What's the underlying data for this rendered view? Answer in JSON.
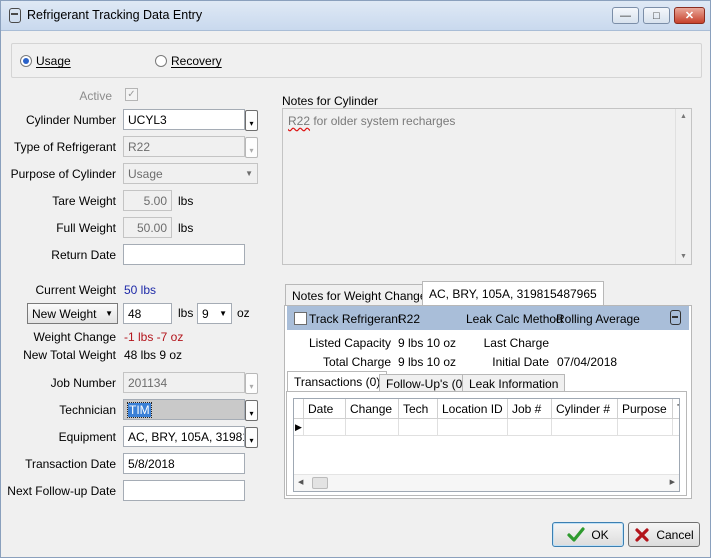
{
  "window": {
    "title": "Refrigerant Tracking Data Entry",
    "minimize": "—",
    "maximize": "□",
    "close": "✕"
  },
  "mode": {
    "usage": "Usage",
    "recovery": "Recovery",
    "selected": "usage"
  },
  "form": {
    "active_label": "Active",
    "cylinder_number_label": "Cylinder Number",
    "cylinder_number": "UCYL3",
    "type_label": "Type of Refrigerant",
    "type_value": "R22",
    "purpose_label": "Purpose of Cylinder",
    "purpose_value": "Usage",
    "tare_label": "Tare Weight",
    "tare_value": "5.00",
    "full_label": "Full Weight",
    "full_value": "50.00",
    "unit_lbs": "lbs",
    "unit_oz": "oz",
    "return_date_label": "Return Date",
    "return_date": "",
    "current_weight_label": "Current Weight",
    "current_weight": "50 lbs",
    "weight_mode": "New Weight",
    "weight_lbs": "48",
    "weight_oz": "9",
    "weight_change_label": "Weight Change",
    "weight_change": "-1 lbs -7 oz",
    "new_total_label": "New Total Weight",
    "new_total": "48 lbs 9 oz",
    "job_number_label": "Job Number",
    "job_number": "201134",
    "technician_label": "Technician",
    "technician": "TIM",
    "equipment_label": "Equipment",
    "equipment": "AC, BRY, 105A, 319815",
    "transaction_date_label": "Transaction Date",
    "transaction_date": "5/8/2018",
    "next_followup_label": "Next Follow-up Date",
    "next_followup": ""
  },
  "notes": {
    "label": "Notes for Cylinder",
    "text_code": "R22",
    "text_rest": " for older system recharges"
  },
  "tabs": {
    "weight_notes": "Notes for Weight Changes",
    "equipment_tab": "AC, BRY, 105A, 319815487965"
  },
  "equipment_panel": {
    "track_label": "Track Refrigerant",
    "track_value": "R22",
    "leak_calc_label": "Leak Calc Method",
    "leak_calc_value": "Rolling Average",
    "listed_capacity_label": "Listed Capacity",
    "listed_capacity": "9 lbs 10 oz",
    "last_charge_label": "Last Charge",
    "last_charge": "",
    "total_charge_label": "Total Charge",
    "total_charge": "9 lbs 10 oz",
    "initial_date_label": "Initial Date",
    "initial_date": "07/04/2018"
  },
  "subtabs": {
    "transactions": "Transactions (0)",
    "followups": "Follow-Up's (0)",
    "leak_info": "Leak Information"
  },
  "grid": {
    "columns": [
      "Date",
      "Change",
      "Tech",
      "Location ID",
      "Job #",
      "Cylinder #",
      "Purpose",
      "T"
    ],
    "row_marker": "▶"
  },
  "buttons": {
    "ok": "OK",
    "cancel": "Cancel"
  },
  "colors": {
    "accent_bar": "#a9bed9",
    "ok_check": "#2e9a2e",
    "cancel_x": "#b3141b"
  }
}
